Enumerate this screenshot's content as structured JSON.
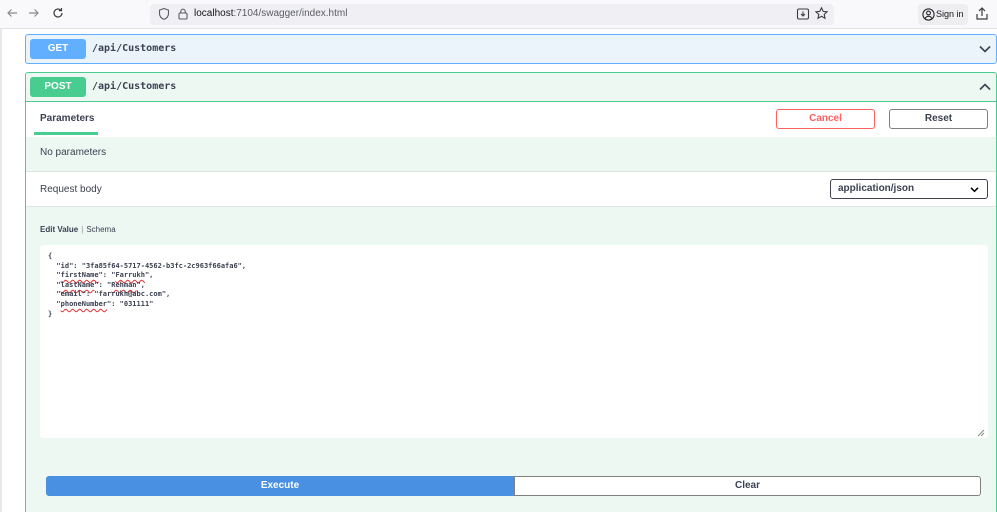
{
  "browser": {
    "url_host": "localhost",
    "url_path": ":7104/swagger/index.html",
    "signin_label": "Sign in"
  },
  "operations": [
    {
      "method": "GET",
      "path": "/api/Customers",
      "expanded": false
    },
    {
      "method": "POST",
      "path": "/api/Customers",
      "expanded": true
    }
  ],
  "post_panel": {
    "parameters_tab": "Parameters",
    "cancel_label": "Cancel",
    "reset_label": "Reset",
    "no_parameters": "No parameters",
    "request_body_label": "Request body",
    "content_type": "application/json",
    "tab_edit_value": "Edit Value",
    "tab_schema": "Schema",
    "body_json": {
      "id": "3fa85f64-5717-4562-b3fc-2c963f66afa6",
      "firstName": "Farrukh",
      "lastName": "Rehman",
      "email": "farrukh@abc.com",
      "phoneNumber": "031111"
    },
    "execute_label": "Execute",
    "clear_label": "Clear"
  },
  "colors": {
    "get": "#61affe",
    "post": "#49cc90",
    "execute": "#4990e2",
    "cancel": "#ff6060"
  },
  "icons": [
    "back-arrow-icon",
    "forward-arrow-icon",
    "reload-icon",
    "shield-icon",
    "lock-icon",
    "reader-view-icon",
    "bookmark-star-icon",
    "user-icon",
    "share-icon",
    "chevron-down-icon",
    "chevron-up-icon",
    "caret-down-icon",
    "resize-grip-icon"
  ]
}
